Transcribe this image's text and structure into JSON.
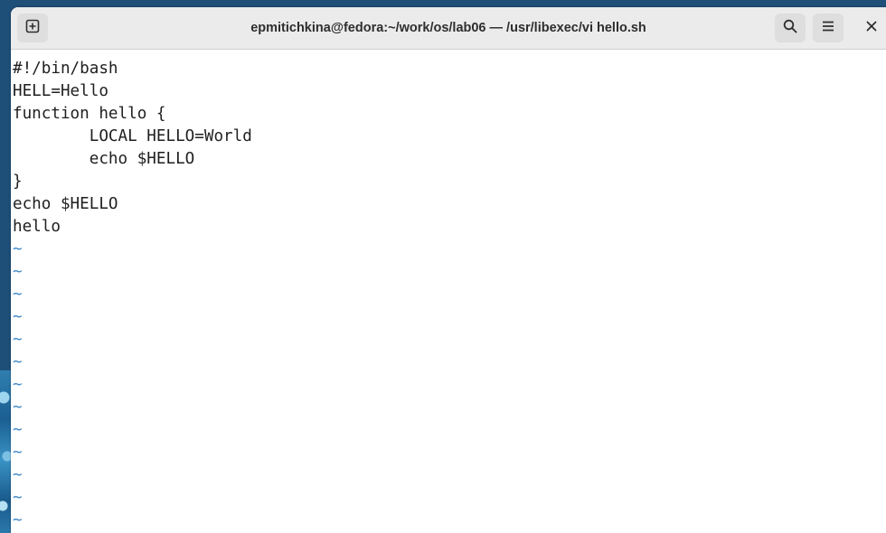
{
  "window": {
    "title": "epmitichkina@fedora:~/work/os/lab06 — /usr/libexec/vi hello.sh",
    "close_label": "✕"
  },
  "editor": {
    "lines": [
      "#!/bin/bash",
      "HELL=Hello",
      "function hello {",
      "        LOCAL HELLO=World",
      "        echo $HELLO",
      "}",
      "echo $HELLO",
      "hello"
    ],
    "empty_line_marker": "~",
    "empty_line_count": 13
  },
  "icons": {
    "new_tab": "new-tab-icon",
    "search": "search-icon",
    "menu": "hamburger-menu-icon",
    "close": "close-icon"
  },
  "colors": {
    "tilde": "#3f87c8",
    "titlebar": "#ebebeb"
  }
}
